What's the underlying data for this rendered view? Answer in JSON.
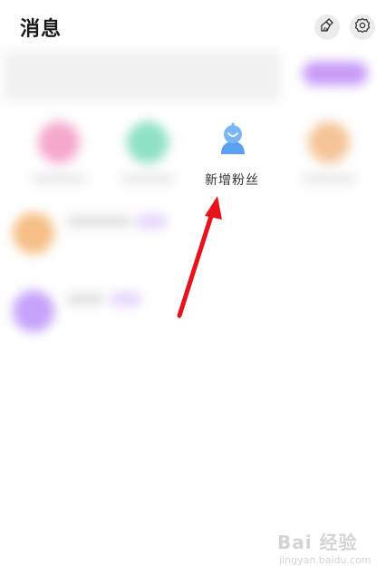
{
  "header": {
    "title": "消息",
    "actions": [
      {
        "name": "clear-unread",
        "icon": "broom-icon"
      },
      {
        "name": "settings",
        "icon": "gear-icon"
      }
    ]
  },
  "entries": [
    {
      "label": "新增粉丝",
      "icon": "fans-icon",
      "color": "#5aa0f0"
    }
  ],
  "blurred_entry_colors": [
    "#f5a8cc",
    "#8fe0c4",
    "#f5c499"
  ],
  "row_avatar_colors": [
    "#f6bf86",
    "#c6a2fa"
  ],
  "banner_button_color": "#c79bf7",
  "watermark": {
    "text": "Bai 经验",
    "sub": "jingyan.baidu.com"
  },
  "annotation_color": "#e8121c"
}
